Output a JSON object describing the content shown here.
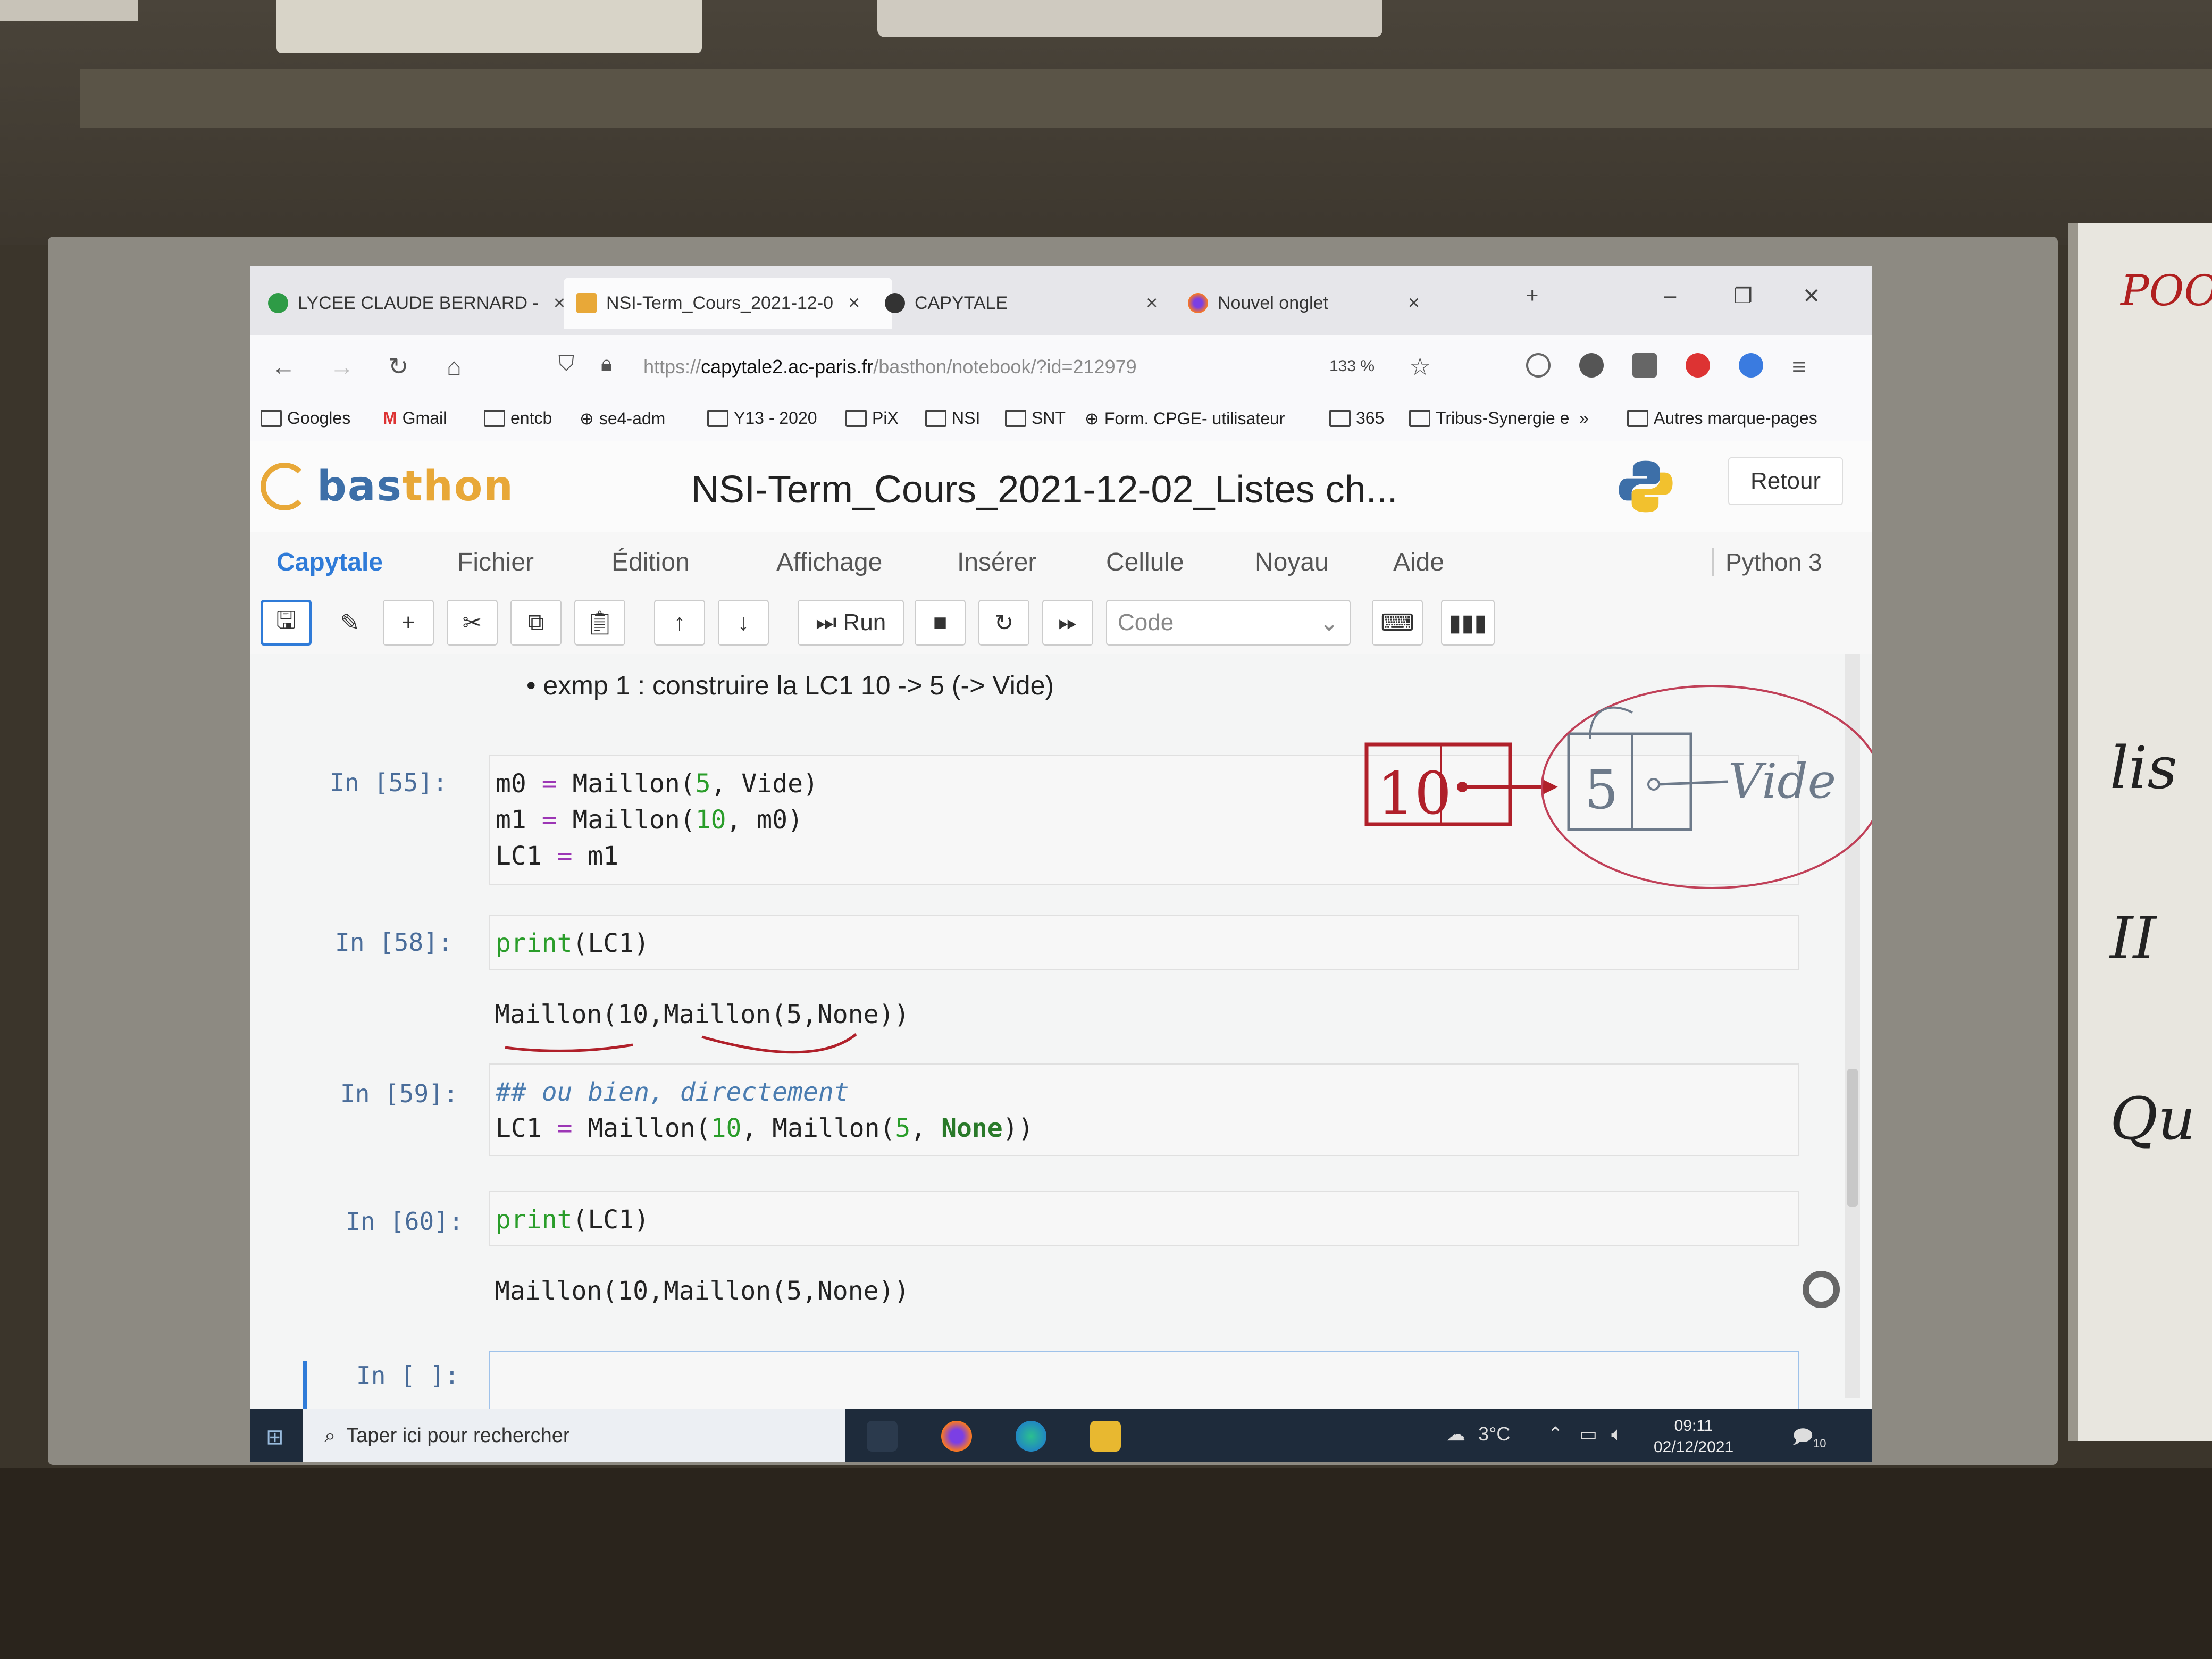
{
  "browser": {
    "tabs": [
      {
        "label": "LYCEE CLAUDE BERNARD -",
        "close": "×"
      },
      {
        "label": "NSI-Term_Cours_2021-12-0",
        "close": "×"
      },
      {
        "label": "CAPYTALE",
        "close": "×"
      },
      {
        "label": "Nouvel onglet",
        "close": "×"
      }
    ],
    "new_tab": "+",
    "window": {
      "minimize": "–",
      "restore": "❐",
      "close": "✕"
    },
    "url_prefix": "https://",
    "url_host": "capytale2.ac-paris.fr",
    "url_path": "/basthon/notebook/?id=212979",
    "zoom": "133 %"
  },
  "bookmarks": [
    {
      "label": "Googles"
    },
    {
      "label": "Gmail"
    },
    {
      "label": "entcb"
    },
    {
      "label": "se4-adm"
    },
    {
      "label": "Y13 - 2020"
    },
    {
      "label": "PiX"
    },
    {
      "label": "NSI"
    },
    {
      "label": "SNT"
    },
    {
      "label": "Form. CPGE- utilisateur"
    },
    {
      "label": "365"
    },
    {
      "label": "Tribus-Synergie e"
    },
    {
      "label": "Autres marque-pages"
    }
  ],
  "bookmarks_more": "»",
  "app": {
    "logo_part1": "bas",
    "logo_part2": "thon",
    "notebook_title": "NSI-Term_Cours_2021-12-02_Listes ch...",
    "retour": "Retour",
    "kernel": "Python 3"
  },
  "menu": [
    "Capytale",
    "Fichier",
    "Édition",
    "Affichage",
    "Insérer",
    "Cellule",
    "Noyau",
    "Aide"
  ],
  "toolbar": {
    "run": "Run",
    "cell_type": "Code"
  },
  "notebook": {
    "markdown_bullet": "•",
    "markdown_text": "exmp 1 : construire la LC1 10 -> 5 (-> Vide)",
    "cells": [
      {
        "prompt": "In [55]:"
      },
      {
        "prompt": "In [58]:",
        "output": "Maillon(10,Maillon(5,None))"
      },
      {
        "prompt": "In [59]:"
      },
      {
        "prompt": "In [60]:",
        "output": "Maillon(10,Maillon(5,None))"
      },
      {
        "prompt": "In [ ]:"
      }
    ],
    "code55": {
      "l1a": "m0",
      "l1b": " = ",
      "l1c": "Maillon(",
      "l1d": "5",
      "l1e": ", Vide)",
      "l2a": "m1",
      "l2b": " = ",
      "l2c": "Maillon(",
      "l2d": "10",
      "l2e": ", m0)",
      "l3a": "LC1",
      "l3b": " = ",
      "l3c": "m1"
    },
    "code58": {
      "fn": "print",
      "arg": "(LC1)"
    },
    "code59": {
      "comment": "## ou bien, directement",
      "l2a": "LC1",
      "l2b": " = ",
      "l2c": "Maillon(",
      "l2d": "10",
      "l2e": ", Maillon(",
      "l2f": "5",
      "l2g": ", ",
      "l2h": "None",
      "l2i": "))"
    },
    "code60": {
      "fn": "print",
      "arg": "(LC1)"
    }
  },
  "annotations": {
    "box1": "10",
    "box2": "5",
    "vide": "Vide"
  },
  "taskbar": {
    "search_placeholder": "Taper ici pour rechercher",
    "weather": "3°C",
    "time": "09:11",
    "date": "02/12/2021",
    "notif_count": "10"
  },
  "whiteboard": {
    "w1": "POO",
    "w2": "lis",
    "w3": "II",
    "w4": "Qu"
  }
}
